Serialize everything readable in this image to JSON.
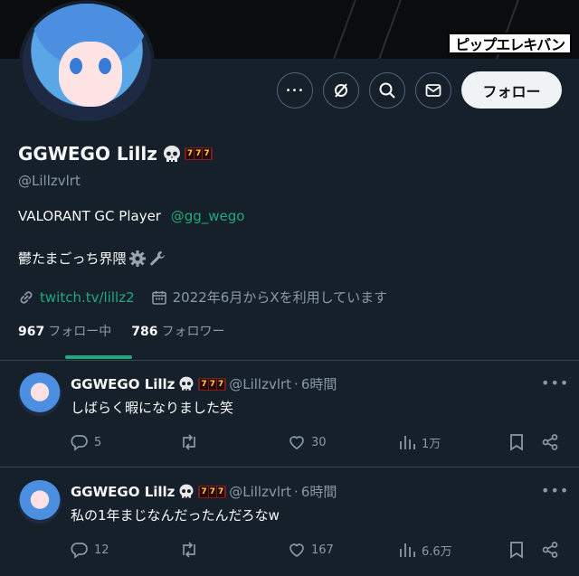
{
  "banner": {
    "logo_text": "ピップエレキバン"
  },
  "actions": {
    "more_label": "•••",
    "follow_label": "フォロー"
  },
  "profile": {
    "display_name": "GGWEGO Lillz",
    "name_emoji_slot": "777",
    "handle": "@Lillzvlrt",
    "bio_line1_text": "VALORANT GC Player",
    "bio_mention": "@gg_wego",
    "bio_line2_text": "鬱たまごっち界隈",
    "link": "twitch.tv/lillz2",
    "joined": "2022年6月からXを利用しています",
    "following_count": "967",
    "following_label": "フォロー中",
    "followers_count": "786",
    "followers_label": "フォロワー"
  },
  "tweets": [
    {
      "display_name": "GGWEGO Lillz",
      "slot": "777",
      "handle": "@Lillzvlrt",
      "separator": "·",
      "time": "6時間",
      "text": "しばらく暇になりました笑",
      "replies": "5",
      "retweets": "",
      "likes": "30",
      "views": "1万"
    },
    {
      "display_name": "GGWEGO Lillz",
      "slot": "777",
      "handle": "@Lillzvlrt",
      "separator": "·",
      "time": "6時間",
      "text": "私の1年まじなんだったんだろなw",
      "replies": "12",
      "retweets": "",
      "likes": "167",
      "views": "6.6万"
    }
  ],
  "colors": {
    "background": "#15202b",
    "accent": "#1fa87d",
    "secondary_text": "#8b98a5",
    "follow_button": "#eff3f4"
  },
  "icons": [
    "more-icon",
    "unfollow-alert-icon",
    "search-icon",
    "message-icon",
    "link-icon",
    "calendar-icon",
    "gear-icon",
    "wrench-icon",
    "skull-icon",
    "reply-icon",
    "retweet-icon",
    "like-icon",
    "views-icon",
    "bookmark-icon",
    "share-icon"
  ]
}
